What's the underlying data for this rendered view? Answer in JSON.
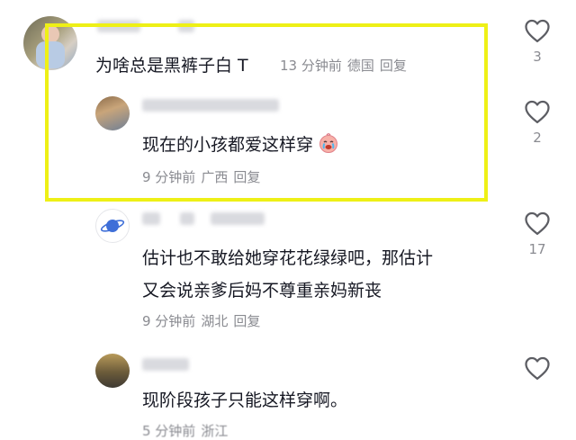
{
  "comments": [
    {
      "text": "为啥总是黑裤子白 T",
      "time": "13 分钟前",
      "location": "德国",
      "reply_label": "回复",
      "likes": "3"
    },
    {
      "text": "现在的小孩都爱这样穿",
      "emoji_icon": "crying-face-emoji",
      "time": "9 分钟前",
      "location": "广西",
      "reply_label": "回复",
      "likes": "2"
    },
    {
      "text_line1": "估计也不敢给她穿花花绿绿吧，那估计",
      "text_line2": "又会说亲爹后妈不尊重亲妈新丧",
      "time": "9 分钟前",
      "location": "湖北",
      "reply_label": "回复",
      "likes": "17"
    },
    {
      "text": "现阶段孩子只能这样穿啊。",
      "time": "5 分钟前",
      "location": "浙江"
    }
  ],
  "colors": {
    "highlight_border": "#eef016",
    "meta_text": "#8a8b91",
    "main_text": "#161823"
  }
}
